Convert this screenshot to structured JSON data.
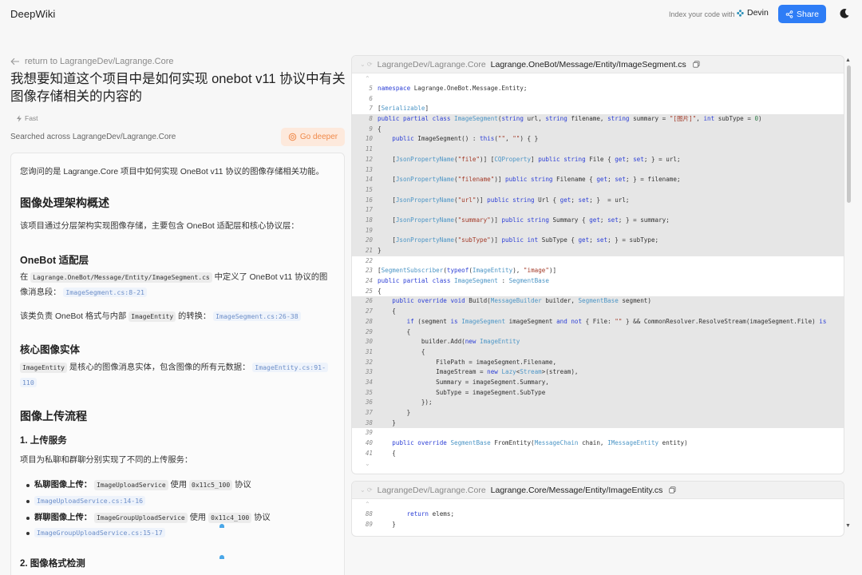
{
  "header": {
    "logo": "DeepWiki",
    "index_text": "Index your code with",
    "devin_label": "Devin",
    "share_label": "Share"
  },
  "left": {
    "back_link": "return to LagrangeDev/Lagrange.Core",
    "question": "我想要知道这个项目中是如何实现 onebot v11 协议中有关图像存储相关的内容的",
    "mode": "Fast",
    "searched": "Searched across LagrangeDev/Lagrange.Core",
    "go_deeper": "Go deeper"
  },
  "answer": {
    "intro": "您询问的是 Lagrange.Core 项目中如何实现 OneBot v11 协议的图像存储相关功能。",
    "h_arch": "图像处理架构概述",
    "p_arch": "该项目通过分层架构实现图像存储，主要包含 OneBot 适配层和核心协议层：",
    "h_onebot": "OneBot 适配层",
    "p_onebot_pre": "在",
    "p_onebot_code": "Lagrange.OneBot/Message/Entity/ImageSegment.cs",
    "p_onebot_post": "中定义了 OneBot v11 协议的图",
    "p_onebot_line2": "像消息段：",
    "ref_1": "ImageSegment.cs:8-21",
    "p_conv_pre": "该类负责 OneBot 格式与内部",
    "p_conv_code": "ImageEntity",
    "p_conv_post": "的转换：",
    "ref_2": "ImageSegment.cs:26-38",
    "h_core": "核心图像实体",
    "p_core_code": "ImageEntity",
    "p_core_text": "是核心的图像消息实体，包含图像的所有元数据：",
    "ref_3a": "ImageEntity.cs:91-",
    "ref_3b": "110",
    "h_upload": "图像上传流程",
    "h_service": "1. 上传服务",
    "p_service": "项目为私聊和群聊分别实现了不同的上传服务：",
    "bullet1_label": "私聊图像上传：",
    "bullet1_code1": "ImageUploadService",
    "bullet1_mid": "使用",
    "bullet1_code2": "0x11c5_100",
    "bullet1_end": "协议",
    "bullet1_ref": "ImageUploadService.cs:14-16",
    "bullet2_label": "群聊图像上传：",
    "bullet2_code1": "ImageGroupUploadService",
    "bullet2_mid": "使用",
    "bullet2_code2": "0x11c4_100",
    "bullet2_end": "协议",
    "bullet2_ref": "ImageGroupUploadService.cs:15-17",
    "h_format": "2. 图像格式检测"
  },
  "panel1": {
    "repo": "LagrangeDev/Lagrange.Core",
    "path": "Lagrange.OneBot/Message/Entity/ImageSegment.cs",
    "lines": [
      {
        "n": "5",
        "hl": false,
        "html": "<span class=\"kw\">namespace</span> Lagrange.OneBot.Message.Entity;"
      },
      {
        "n": "6",
        "hl": false,
        "html": ""
      },
      {
        "n": "7",
        "hl": false,
        "html": "[<span class=\"ty\">Serializable</span>]"
      },
      {
        "n": "8",
        "hl": true,
        "html": "<span class=\"kw\">public partial class</span> <span class=\"ty\">ImageSegment</span>(<span class=\"kw\">string</span> url, <span class=\"kw\">string</span> filename, <span class=\"kw\">string</span> summary = <span class=\"st\">\"[图片]\"</span>, <span class=\"kw\">int</span> subType = <span class=\"cm\">0</span>)"
      },
      {
        "n": "9",
        "hl": true,
        "html": "{"
      },
      {
        "n": "10",
        "hl": true,
        "html": "    <span class=\"kw\">public</span> ImageSegment() : <span class=\"kw\">this</span>(<span class=\"st\">\"\"</span>, <span class=\"st\">\"\"</span>) { }"
      },
      {
        "n": "11",
        "hl": true,
        "html": ""
      },
      {
        "n": "12",
        "hl": true,
        "html": "    [<span class=\"ty\">JsonPropertyName</span>(<span class=\"st\">\"file\"</span>)] [<span class=\"ty\">CQProperty</span>] <span class=\"kw\">public string</span> File { <span class=\"kw\">get</span>; <span class=\"kw\">set</span>; } = url;"
      },
      {
        "n": "13",
        "hl": true,
        "html": ""
      },
      {
        "n": "14",
        "hl": true,
        "html": "    [<span class=\"ty\">JsonPropertyName</span>(<span class=\"st\">\"filename\"</span>)] <span class=\"kw\">public string</span> Filename { <span class=\"kw\">get</span>; <span class=\"kw\">set</span>; } = filename;"
      },
      {
        "n": "15",
        "hl": true,
        "html": ""
      },
      {
        "n": "16",
        "hl": true,
        "html": "    [<span class=\"ty\">JsonPropertyName</span>(<span class=\"st\">\"url\"</span>)] <span class=\"kw\">public string</span> Url { <span class=\"kw\">get</span>; <span class=\"kw\">set</span>; }  = url;"
      },
      {
        "n": "17",
        "hl": true,
        "html": ""
      },
      {
        "n": "18",
        "hl": true,
        "html": "    [<span class=\"ty\">JsonPropertyName</span>(<span class=\"st\">\"summary\"</span>)] <span class=\"kw\">public string</span> Summary { <span class=\"kw\">get</span>; <span class=\"kw\">set</span>; } = summary;"
      },
      {
        "n": "19",
        "hl": true,
        "html": ""
      },
      {
        "n": "20",
        "hl": true,
        "html": "    [<span class=\"ty\">JsonPropertyName</span>(<span class=\"st\">\"subType\"</span>)] <span class=\"kw\">public int</span> SubType { <span class=\"kw\">get</span>; <span class=\"kw\">set</span>; } = subType;"
      },
      {
        "n": "21",
        "hl": true,
        "html": "}"
      },
      {
        "n": "22",
        "hl": false,
        "html": ""
      },
      {
        "n": "23",
        "hl": false,
        "html": "[<span class=\"ty\">SegmentSubscriber</span>(<span class=\"kw\">typeof</span>(<span class=\"ty\">ImageEntity</span>), <span class=\"st\">\"image\"</span>)]"
      },
      {
        "n": "24",
        "hl": false,
        "html": "<span class=\"kw\">public partial class</span> <span class=\"ty\">ImageSegment</span> : <span class=\"ty\">SegmentBase</span>"
      },
      {
        "n": "25",
        "hl": false,
        "html": "{"
      },
      {
        "n": "26",
        "hl": true,
        "html": "    <span class=\"kw\">public override void</span> Build(<span class=\"ty\">MessageBuilder</span> builder, <span class=\"ty\">SegmentBase</span> segment)"
      },
      {
        "n": "27",
        "hl": true,
        "html": "    {"
      },
      {
        "n": "28",
        "hl": true,
        "html": "        <span class=\"kw\">if</span> (segment <span class=\"kw\">is</span> <span class=\"ty\">ImageSegment</span> imageSegment <span class=\"kw\">and not</span> { File: <span class=\"st\">\"\"</span> } &amp;&amp; CommonResolver.ResolveStream(imageSegment.File) <span class=\"kw\">is</span>"
      },
      {
        "n": "29",
        "hl": true,
        "html": "        {"
      },
      {
        "n": "30",
        "hl": true,
        "html": "            builder.Add(<span class=\"kw\">new</span> <span class=\"ty\">ImageEntity</span>"
      },
      {
        "n": "31",
        "hl": true,
        "html": "            {"
      },
      {
        "n": "32",
        "hl": true,
        "html": "                FilePath = imageSegment.Filename,"
      },
      {
        "n": "33",
        "hl": true,
        "html": "                ImageStream = <span class=\"kw\">new</span> <span class=\"ty\">Lazy</span>&lt;<span class=\"ty\">Stream</span>&gt;(stream),"
      },
      {
        "n": "34",
        "hl": true,
        "html": "                Summary = imageSegment.Summary,"
      },
      {
        "n": "35",
        "hl": true,
        "html": "                SubType = imageSegment.SubType"
      },
      {
        "n": "36",
        "hl": true,
        "html": "            });"
      },
      {
        "n": "37",
        "hl": true,
        "html": "        }"
      },
      {
        "n": "38",
        "hl": true,
        "html": "    }"
      },
      {
        "n": "39",
        "hl": false,
        "html": ""
      },
      {
        "n": "40",
        "hl": false,
        "html": "    <span class=\"kw\">public override</span> <span class=\"ty\">SegmentBase</span> FromEntity(<span class=\"ty\">MessageChain</span> chain, <span class=\"ty\">IMessageEntity</span> entity)"
      },
      {
        "n": "41",
        "hl": false,
        "html": "    {"
      }
    ]
  },
  "panel2": {
    "repo": "LagrangeDev/Lagrange.Core",
    "path": "Lagrange.Core/Message/Entity/ImageEntity.cs",
    "lines": [
      {
        "n": "88",
        "hl": false,
        "html": "        <span class=\"kw\">return</span> elems;"
      },
      {
        "n": "89",
        "hl": false,
        "html": "    }"
      }
    ]
  }
}
